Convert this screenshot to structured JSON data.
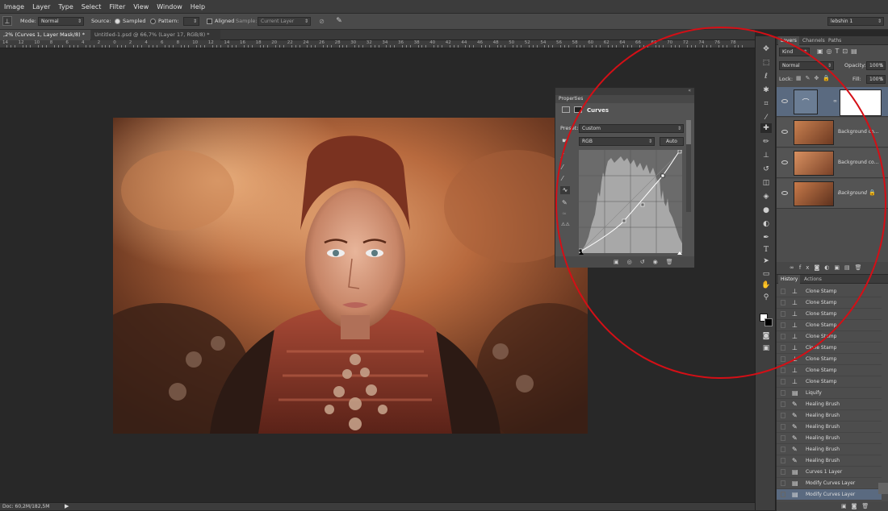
{
  "menu": [
    "Image",
    "Layer",
    "Type",
    "Select",
    "Filter",
    "View",
    "Window",
    "Help"
  ],
  "options_bar": {
    "mode_label": "Mode:",
    "mode_value": "Normal",
    "source_label": "Source:",
    "sampled_label": "Sampled",
    "pattern_label": "Pattern:",
    "aligned_label": "Aligned",
    "sample_label": "Sample:",
    "sample_value": "Current Layer",
    "workspace_value": "lebshin 1"
  },
  "doc_tabs": [
    {
      "label": ",2% (Curves 1, Layer Mask/8) *"
    },
    {
      "label": "Untitled-1.psd @ 66,7% (Layer 17, RGB/8) *"
    }
  ],
  "ruler_numbers": [
    "14",
    "12",
    "10",
    "8",
    "6",
    "4",
    "2",
    "0",
    "2",
    "4",
    "6",
    "8",
    "10",
    "12",
    "14",
    "16",
    "18",
    "20",
    "22",
    "24",
    "26",
    "28",
    "30",
    "32",
    "34",
    "36",
    "38",
    "40",
    "42",
    "44",
    "46",
    "48",
    "50",
    "52",
    "54",
    "56",
    "58",
    "60",
    "62",
    "64",
    "66",
    "68",
    "70",
    "72",
    "74",
    "76",
    "78"
  ],
  "status": {
    "doc": "Doc: 60,2M/182,5M"
  },
  "properties": {
    "title": "Properties",
    "header": "Curves",
    "preset_label": "Preset:",
    "preset_value": "Custom",
    "channel_value": "RGB",
    "auto_label": "Auto"
  },
  "layers_panel": {
    "tabs": [
      "Layers",
      "Channels",
      "Paths"
    ],
    "kind_value": "Kind",
    "blend_value": "Normal",
    "opacity_label": "Opacity:",
    "opacity_value": "100%",
    "lock_label": "Lock:",
    "fill_label": "Fill:",
    "fill_value": "100%",
    "layers": [
      {
        "name": ""
      },
      {
        "name": "Background co..."
      },
      {
        "name": "Background co..."
      },
      {
        "name": "Background"
      }
    ]
  },
  "history_panel": {
    "tabs": [
      "History",
      "Actions"
    ],
    "items": [
      {
        "label": "Clone Stamp",
        "icon": "clone-stamp-icon"
      },
      {
        "label": "Clone Stamp",
        "icon": "clone-stamp-icon"
      },
      {
        "label": "Clone Stamp",
        "icon": "clone-stamp-icon"
      },
      {
        "label": "Clone Stamp",
        "icon": "clone-stamp-icon"
      },
      {
        "label": "Clone Stamp",
        "icon": "clone-stamp-icon"
      },
      {
        "label": "Clone Stamp",
        "icon": "clone-stamp-icon"
      },
      {
        "label": "Clone Stamp",
        "icon": "clone-stamp-icon"
      },
      {
        "label": "Clone Stamp",
        "icon": "clone-stamp-icon"
      },
      {
        "label": "Clone Stamp",
        "icon": "clone-stamp-icon"
      },
      {
        "label": "Liquify",
        "icon": "filter-icon"
      },
      {
        "label": "Healing Brush",
        "icon": "healing-brush-icon"
      },
      {
        "label": "Healing Brush",
        "icon": "healing-brush-icon"
      },
      {
        "label": "Healing Brush",
        "icon": "healing-brush-icon"
      },
      {
        "label": "Healing Brush",
        "icon": "healing-brush-icon"
      },
      {
        "label": "Healing Brush",
        "icon": "healing-brush-icon"
      },
      {
        "label": "Healing Brush",
        "icon": "healing-brush-icon"
      },
      {
        "label": "Curves 1 Layer",
        "icon": "layer-icon"
      },
      {
        "label": "Modify Curves Layer",
        "icon": "layer-icon"
      },
      {
        "label": "Modify Curves Layer",
        "icon": "layer-icon"
      }
    ]
  },
  "colors": {
    "annotation": "#d40f16",
    "selection": "#5a6a80"
  }
}
